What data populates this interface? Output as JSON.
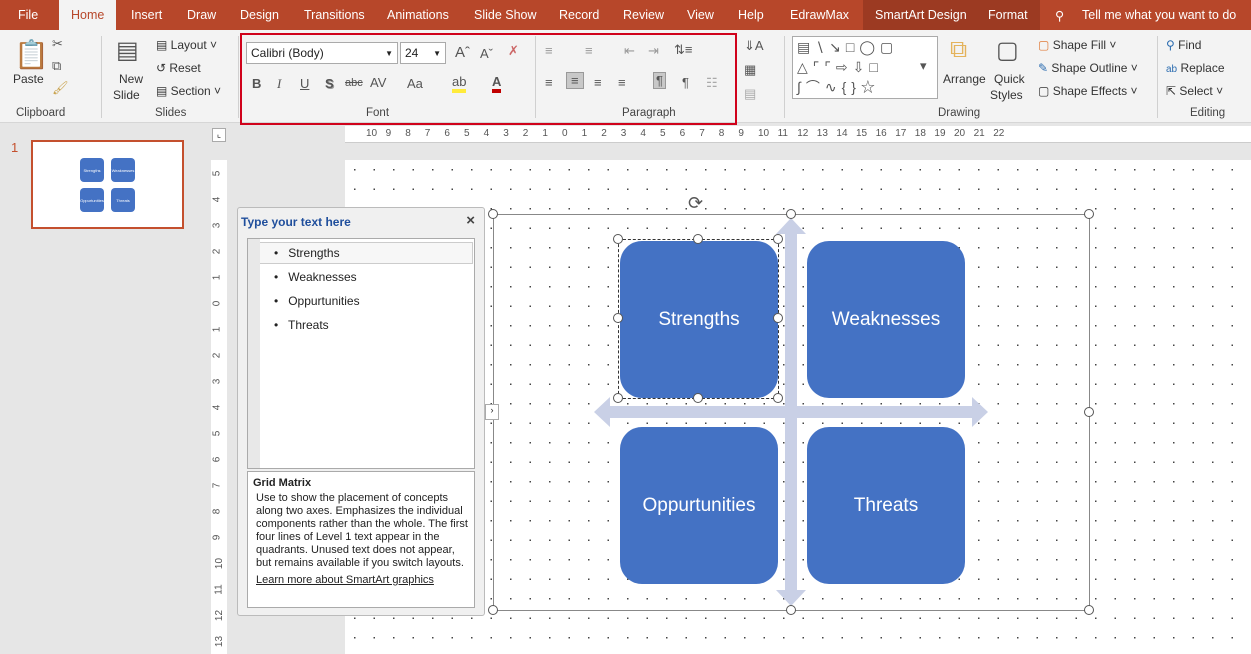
{
  "tabs": [
    "File",
    "Home",
    "Insert",
    "Draw",
    "Design",
    "Transitions",
    "Animations",
    "Slide Show",
    "Record",
    "Review",
    "View",
    "Help",
    "EdrawMax",
    "SmartArt Design",
    "Format"
  ],
  "tell_me": "Tell me what you want to do",
  "ribbon": {
    "clipboard": {
      "paste": "Paste",
      "label": "Clipboard"
    },
    "slides": {
      "new_slide_1": "New",
      "new_slide_2": "Slide",
      "layout": "Layout",
      "reset": "Reset",
      "section": "Section",
      "label": "Slides"
    },
    "font": {
      "name": "Calibri (Body)",
      "size": "24",
      "label": "Font",
      "buttons": [
        "B",
        "I",
        "U",
        "S",
        "abc",
        "AV",
        "Aa"
      ]
    },
    "paragraph": {
      "label": "Paragraph"
    },
    "drawing": {
      "arrange": "Arrange",
      "quick_styles_1": "Quick",
      "quick_styles_2": "Styles",
      "shape_fill": "Shape Fill",
      "shape_outline": "Shape Outline",
      "shape_effects": "Shape Effects",
      "label": "Drawing"
    },
    "editing": {
      "find": "Find",
      "replace": "Replace",
      "select": "Select",
      "label": "Editing"
    }
  },
  "thumbnail": {
    "number": "1",
    "items": [
      "Strengths",
      "Weaknesses",
      "Oppurtunities",
      "Threats"
    ]
  },
  "hruler": [
    "10",
    "9",
    "8",
    "7",
    "6",
    "5",
    "4",
    "3",
    "2",
    "1",
    "0",
    "1",
    "2",
    "3",
    "4",
    "5",
    "6",
    "7",
    "8",
    "9",
    "10",
    "11",
    "12",
    "13",
    "14",
    "15",
    "16",
    "17",
    "18",
    "19",
    "20",
    "21",
    "22"
  ],
  "vruler": [
    "5",
    "4",
    "3",
    "2",
    "1",
    "0",
    "1",
    "2",
    "3",
    "4",
    "5",
    "6",
    "7",
    "8",
    "9",
    "10",
    "11",
    "12",
    "13"
  ],
  "text_pane": {
    "title": "Type your text here",
    "items": [
      "Strengths",
      "Weaknesses",
      "Oppurtunities",
      "Threats"
    ],
    "desc_title": "Grid Matrix",
    "desc": "Use to show the placement of concepts along two axes. Emphasizes the individual components rather than the whole. The first four lines of Level 1 text appear in the quadrants. Unused text does not appear, but remains available if you switch layouts.",
    "link": "Learn more about SmartArt graphics"
  },
  "smartart": {
    "items": [
      "Strengths",
      "Weaknesses",
      "Oppurtunities",
      "Threats"
    ],
    "box_color": "#4472c4",
    "arrow_color": "#c9d0e6"
  },
  "colors": {
    "accent": "#b7472a",
    "highlight_border": "#d0021b"
  }
}
